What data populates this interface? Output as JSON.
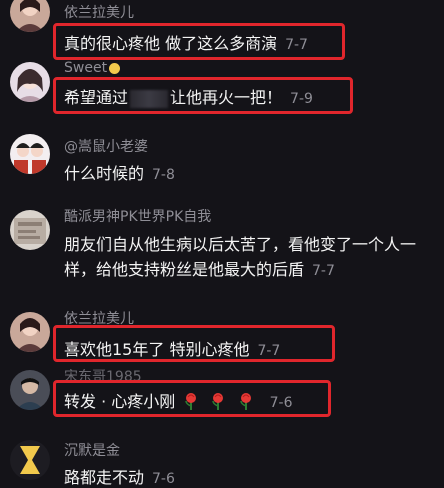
{
  "comments": [
    {
      "username": "依兰拉美儿",
      "text": "真的很心疼他 做了这么多商演",
      "date": "7-7"
    },
    {
      "username": "Sweet",
      "text_before": "希望通过",
      "text_after": "让他再火一把！",
      "date": "7-9"
    },
    {
      "username": "@嵩鼠小老婆",
      "text": "什么时候的",
      "date": "7-8"
    },
    {
      "username": "酷派男神PK世界PK自我",
      "text": "朋友们自从他生病以后太苦了，看他变了一个人一样，给他支持粉丝是他最大的后盾",
      "date": "7-7"
    },
    {
      "username": "依兰拉美儿",
      "text": "喜欢他15年了 特别心疼他",
      "date": "7-7"
    },
    {
      "username": "宋东哥1985",
      "text": "转发 · 心疼小刚",
      "date": "7-6"
    },
    {
      "username": "沉默是金",
      "text": "路都走不动",
      "date": "7-6"
    }
  ],
  "colors": {
    "highlight": "#e0262c",
    "background": "#141318",
    "text": "#f4f4f4",
    "muted": "#8f8e96"
  },
  "icons": [
    "avatar-icon",
    "rose-emoji-icon",
    "badge-icon"
  ]
}
